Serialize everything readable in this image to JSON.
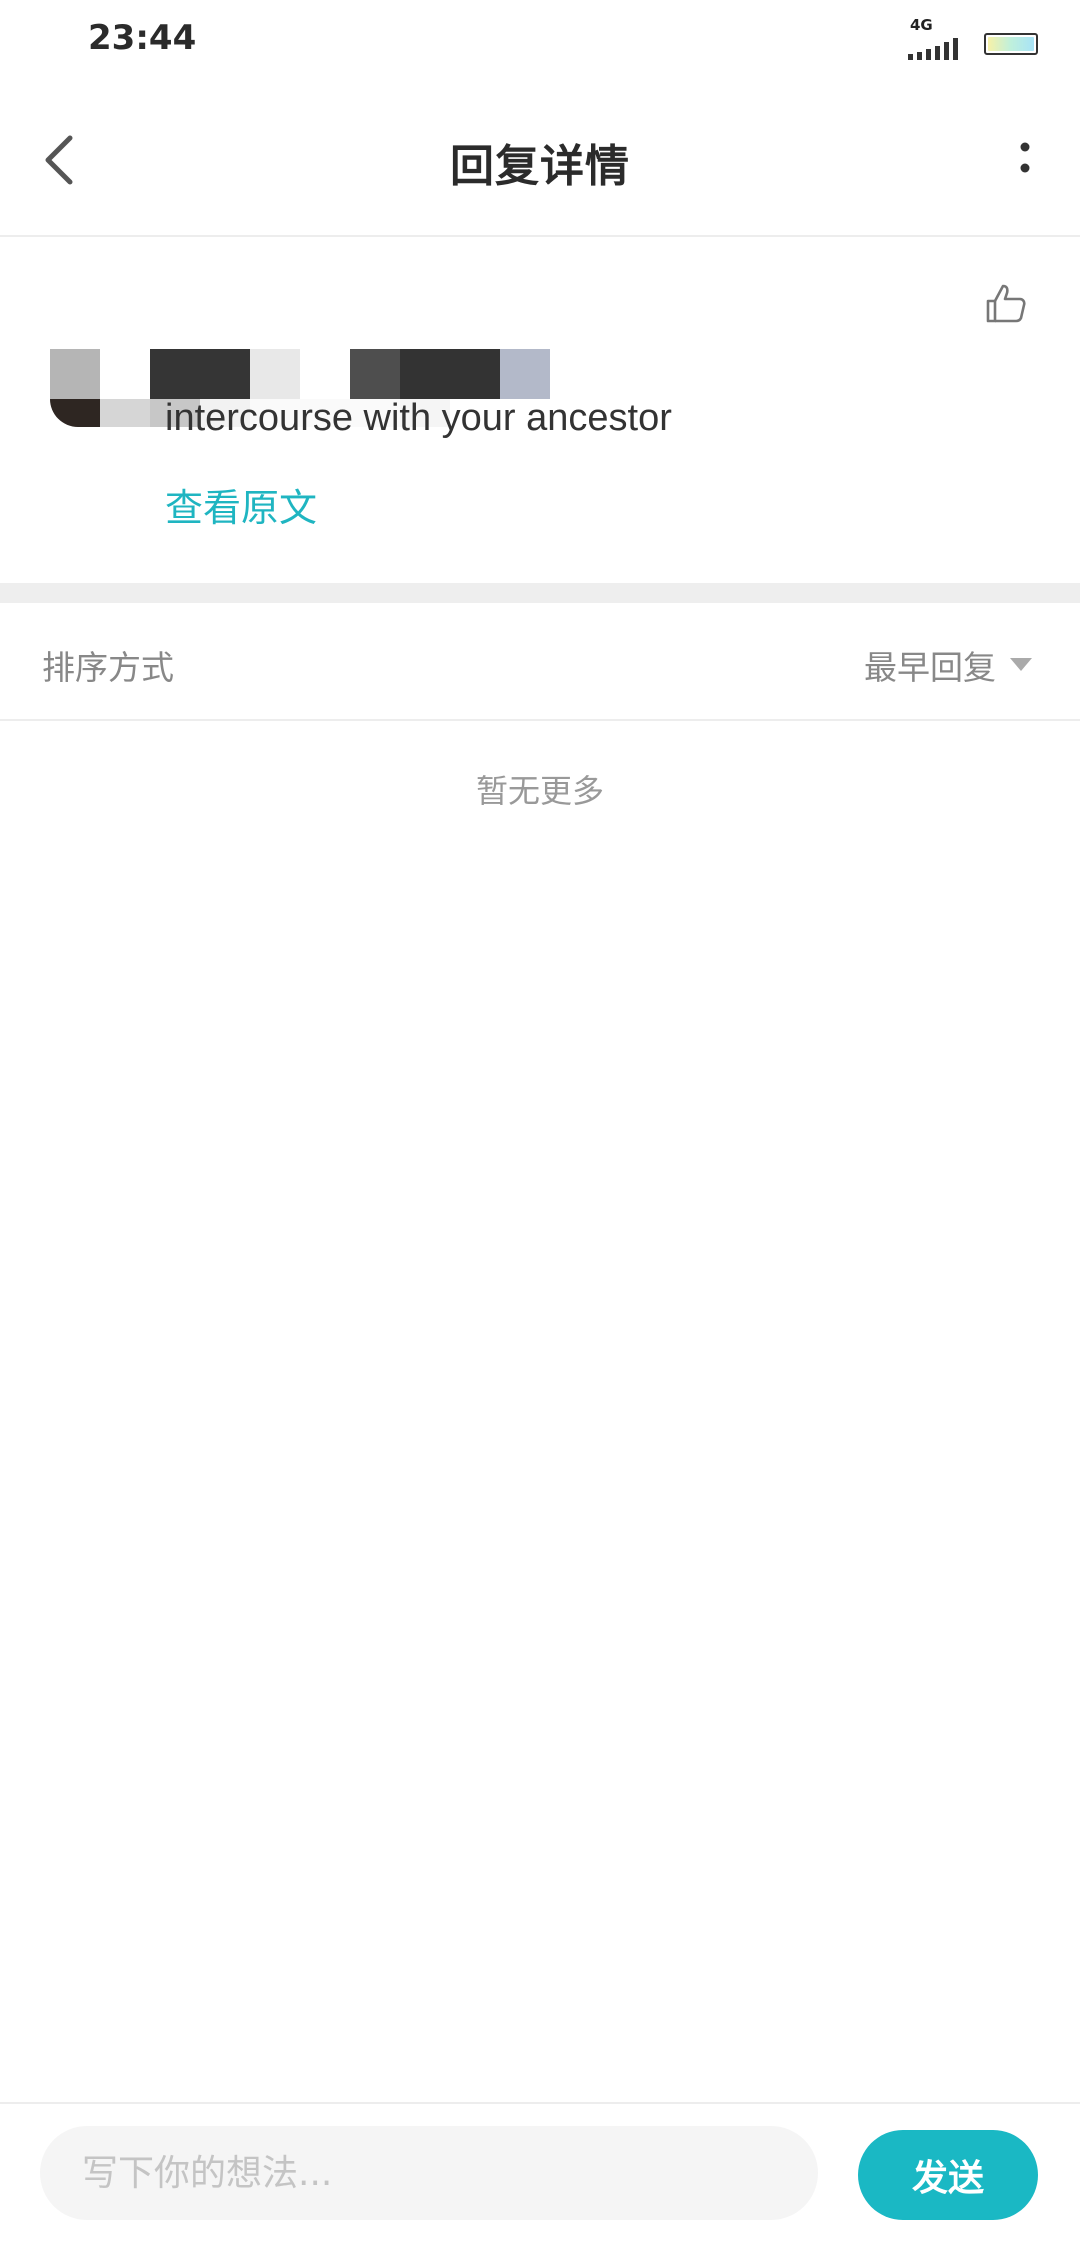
{
  "status_bar": {
    "time": "23:44",
    "network": "4G",
    "icons": [
      "signal-icon",
      "battery-icon"
    ]
  },
  "header": {
    "title": "回复详情",
    "icons": [
      "chevron-left-icon",
      "more-vertical-icon"
    ]
  },
  "reply": {
    "text": "intercourse with your ancestor",
    "view_original": "查看原文",
    "icons": [
      "thumbs-up-icon"
    ]
  },
  "sort": {
    "label": "排序方式",
    "selected": "最早回复",
    "icons": [
      "caret-down-icon"
    ]
  },
  "list": {
    "empty_text": "暂无更多"
  },
  "composer": {
    "placeholder": "写下你的想法...",
    "send_label": "发送"
  },
  "colors": {
    "accent": "#1ab8c4",
    "link": "#1fb5c1",
    "muted_text": "#888888",
    "divider": "#ededed"
  }
}
